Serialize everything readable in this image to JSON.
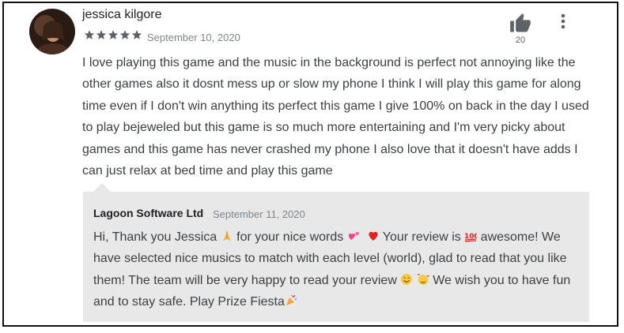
{
  "review": {
    "author": "jessica kilgore",
    "rating": 5,
    "date": "September 10, 2020",
    "likes": "20",
    "text": "I love playing this game and the music in the background is perfect not annoying like the other games also it dosnt mess up or slow my phone I think I will play this game for along time even if I don't win anything its perfect this game I give 100% on back in the day I used to play bejeweled but this game is so much more entertaining and I'm very picky about games and this game has never crashed my phone I also love that it doesn't have adds I can just relax at bed time and play this game"
  },
  "reply": {
    "developer": "Lagoon Software Ltd",
    "date": "September 11, 2020",
    "segments": {
      "s1": "Hi, Thank you Jessica ",
      "s2": " for your nice words ",
      "s3": " Your review is ",
      "s4": " awesome! We have selected nice musics to match with each level (world), glad to read that you like them! The team will be very happy to read your review ",
      "s5": " We wish you to have fun and to stay safe. Play Prize Fiesta"
    }
  },
  "icons": {
    "like": "thumb-up-icon",
    "more": "more-vert-icon",
    "star_color": "#5f6368"
  }
}
